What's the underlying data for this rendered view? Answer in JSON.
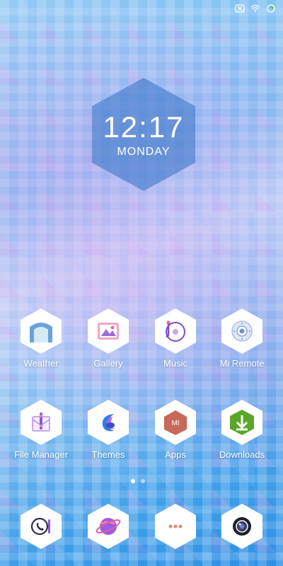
{
  "status": {
    "icons": [
      "sim-off-icon",
      "wifi-icon",
      "battery-charging-icon"
    ]
  },
  "clock": {
    "time": "12:17",
    "day": "MONDAY"
  },
  "apps_row1": [
    {
      "label": "Weather",
      "icon": "weather-icon"
    },
    {
      "label": "Gallery",
      "icon": "gallery-icon"
    },
    {
      "label": "Music",
      "icon": "music-icon"
    },
    {
      "label": "Mi Remote",
      "icon": "remote-icon"
    }
  ],
  "apps_row2": [
    {
      "label": "File Manager",
      "icon": "file-manager-icon"
    },
    {
      "label": "Themes",
      "icon": "themes-icon"
    },
    {
      "label": "Apps",
      "icon": "apps-store-icon"
    },
    {
      "label": "Downloads",
      "icon": "downloads-icon"
    }
  ],
  "dock": [
    {
      "icon": "phone-icon"
    },
    {
      "icon": "browser-icon"
    },
    {
      "icon": "messages-icon"
    },
    {
      "icon": "camera-icon"
    }
  ],
  "page_indicator": {
    "pages": 2,
    "current": 1
  },
  "colors": {
    "accent_green": "#5aa62b",
    "accent_red": "#c8685a",
    "accent_purple": "#8c5bd8"
  }
}
